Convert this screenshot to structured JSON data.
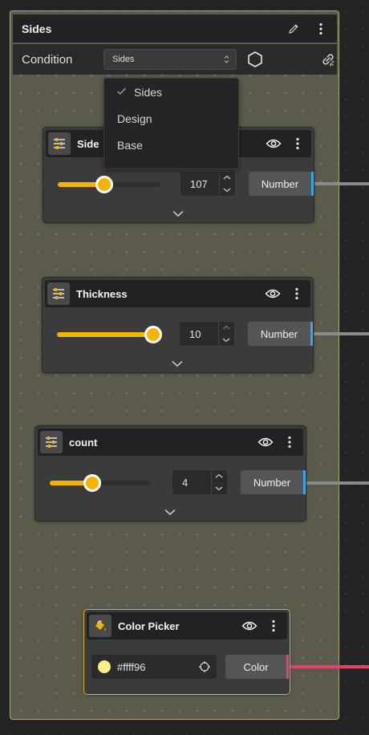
{
  "group": {
    "title": "Sides",
    "condition_label": "Condition",
    "condition_value": "Sides",
    "dropdown_options": [
      "Sides",
      "Design",
      "Base"
    ],
    "selected_option": "Sides",
    "border_color": "#a8a47c",
    "background_color": "#5b5a4b"
  },
  "nodes": [
    {
      "title": "Side",
      "value": "107",
      "slider_fraction": 0.45,
      "output_label": "Number",
      "port_color": "#3aa6e8"
    },
    {
      "title": "Thickness",
      "value": "10",
      "slider_fraction": 1.0,
      "output_label": "Number",
      "port_color": "#3aa6e8"
    },
    {
      "title": "count",
      "value": "4",
      "slider_fraction": 0.42,
      "output_label": "Number",
      "port_color": "#3aa6e8"
    }
  ],
  "color_picker": {
    "title": "Color Picker",
    "hex_value": "#ffff96",
    "swatch_color": "#f7f08a",
    "output_label": "Color",
    "port_color": "#e8416a",
    "border_color": "#d9b23a"
  },
  "icons": {
    "edit": "pencil-icon",
    "menu": "kebab-menu-icon",
    "hexagon": "hexagon-icon",
    "link": "unlink-icon",
    "slider": "sliders-icon",
    "visibility": "eye-icon",
    "expand": "chevron-down-icon",
    "bucket": "paint-bucket-icon",
    "eyedropper": "crosshair-icon"
  },
  "accent_color": "#f4b400"
}
